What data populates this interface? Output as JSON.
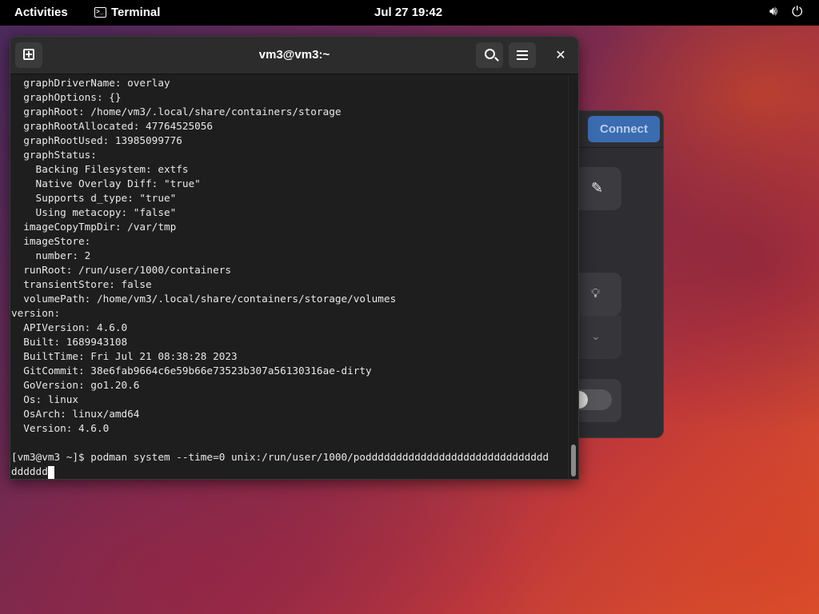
{
  "topbar": {
    "activities": "Activities",
    "app_name": "Terminal",
    "app_icon": "terminal-icon",
    "clock": "Jul 27  19:42",
    "volume_icon": "volume-icon",
    "power_icon": "power-icon"
  },
  "background_window": {
    "connect_label": "Connect",
    "tile_icons": [
      "pencil-icon",
      "lightbulb-icon",
      "chevron-down-icon"
    ],
    "toggle_icon": "toggle-switch"
  },
  "terminal": {
    "title": "vm3@vm3:~",
    "new_tab_icon": "new-tab-icon",
    "search_icon": "search-icon",
    "menu_icon": "hamburger-menu-icon",
    "close_label": "✕",
    "lines": [
      "  graphDriverName: overlay",
      "  graphOptions: {}",
      "  graphRoot: /home/vm3/.local/share/containers/storage",
      "  graphRootAllocated: 47764525056",
      "  graphRootUsed: 13985099776",
      "  graphStatus:",
      "    Backing Filesystem: extfs",
      "    Native Overlay Diff: \"true\"",
      "    Supports d_type: \"true\"",
      "    Using metacopy: \"false\"",
      "  imageCopyTmpDir: /var/tmp",
      "  imageStore:",
      "    number: 2",
      "  runRoot: /run/user/1000/containers",
      "  transientStore: false",
      "  volumePath: /home/vm3/.local/share/containers/storage/volumes",
      "version:",
      "  APIVersion: 4.6.0",
      "  Built: 1689943108",
      "  BuiltTime: Fri Jul 21 08:38:28 2023",
      "  GitCommit: 38e6fab9664c6e59b66e73523b307a56130316ae-dirty",
      "  GoVersion: go1.20.6",
      "  Os: linux",
      "  OsArch: linux/amd64",
      "  Version: 4.6.0",
      "",
      "[vm3@vm3 ~]$ podman system --time=0 unix:/run/user/1000/podddddddddddddddddddddddddddddd"
    ],
    "last_line": "dddddd"
  }
}
